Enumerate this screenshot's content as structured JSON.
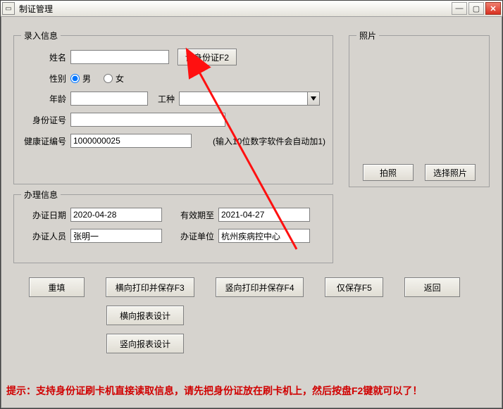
{
  "window": {
    "title": "制证管理"
  },
  "groups": {
    "input": "录入信息",
    "photo": "照片",
    "handle": "办理信息"
  },
  "labels": {
    "name": "姓名",
    "gender": "性别",
    "male": "男",
    "female": "女",
    "age": "年龄",
    "jobtype": "工种",
    "idno": "身份证号",
    "healthno": "健康证编号",
    "healthno_hint": "(输入10位数字软件会自动加1)",
    "issue_date": "办证日期",
    "valid_until": "有效期至",
    "operator": "办证人员",
    "issue_unit": "办证单位"
  },
  "values": {
    "name": "",
    "gender": "male",
    "age": "",
    "jobtype": "",
    "idno": "",
    "healthno": "1000000025",
    "issue_date": "2020-04-28",
    "valid_until": "2021-04-27",
    "operator": "张明一",
    "issue_unit": "杭州疾病控中心"
  },
  "buttons": {
    "read_id": "读身份证F2",
    "take_photo": "拍照",
    "choose_photo": "选择照片",
    "reset": "重填",
    "hprint": "横向打印并保存F3",
    "vprint": "竖向打印并保存F4",
    "saveonly": "仅保存F5",
    "back": "返回",
    "hreport": "横向报表设计",
    "vreport": "竖向报表设计"
  },
  "hint": "提示：支持身份证刷卡机直接读取信息，请先把身份证放在刷卡机上，然后按盘F2键就可以了！"
}
